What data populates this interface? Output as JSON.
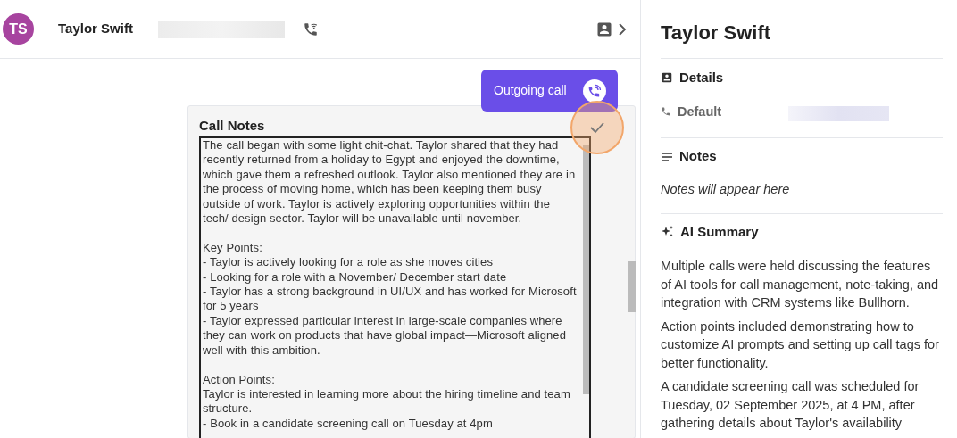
{
  "header": {
    "avatar_initials": "TS",
    "name": "Taylor Swift"
  },
  "message": {
    "label": "Outgoing call"
  },
  "call_notes": {
    "title": "Call Notes",
    "text": "The call began with some light chit-chat. Taylor shared that they had recently returned from a holiday to Egypt and enjoyed the downtime, which gave them a refreshed outlook. Taylor also mentioned they are in the process of moving home, which has been keeping them busy outside of work. Taylor is actively exploring opportunities within the tech/ design sector. Taylor will be unavailable until november.\n\nKey Points:\n- Taylor is actively looking for a role as she moves cities\n- Looking for a role with a November/ December start date\n- Taylor has a strong background in UI/UX and has worked for Microsoft for 5 years\n- Taylor expressed particular interest in large-scale companies where they can work on products that have global impact—Microsoft aligned well with this ambition.\n\nAction Points:\nTaylor is interested in learning more about the hiring timeline and team structure.\n- Book in a candidate screening call on Tuesday at 4pm"
  },
  "panel": {
    "title": "Taylor Swift",
    "details": {
      "label": "Details",
      "rows": [
        {
          "label": "Default"
        }
      ]
    },
    "notes": {
      "label": "Notes",
      "empty_text": "Notes will appear here"
    },
    "ai_summary": {
      "label": "AI Summary",
      "paragraphs": [
        "Multiple calls were held discussing the features of AI tools for call management, note-taking, and integration with CRM systems like Bullhorn.",
        "Action points included demonstrating how to customize AI prompts and setting up call tags for better functionality.",
        "A candidate screening call was scheduled for Tuesday, 02 September 2025, at 4 PM, after gathering details about Taylor's availability"
      ]
    }
  }
}
